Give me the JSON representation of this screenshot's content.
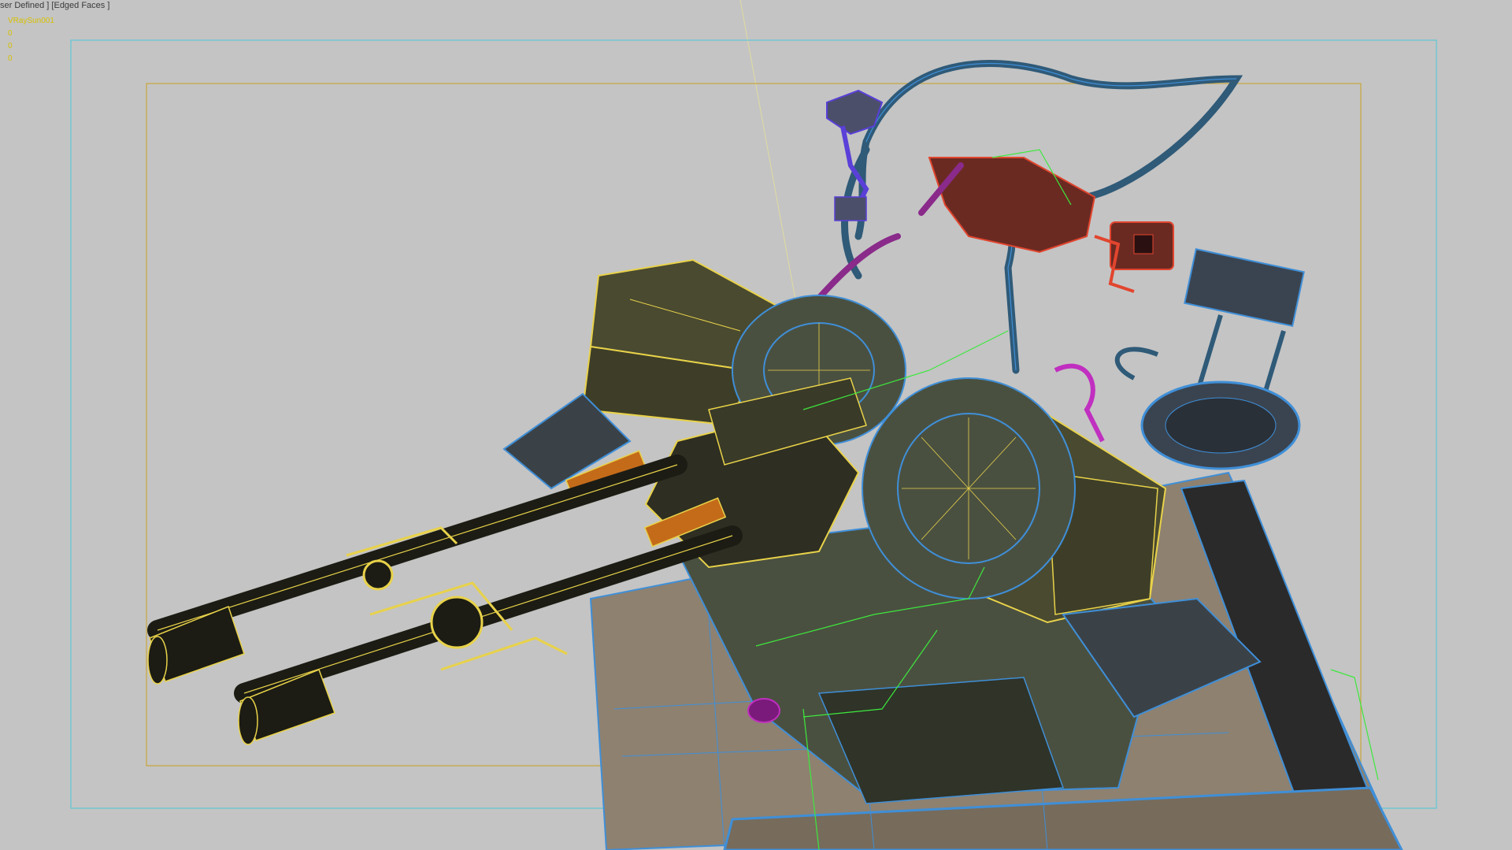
{
  "viewport": {
    "label": "ser Defined ] [Edged Faces ]",
    "selected_object": "VRaySun001",
    "stats": [
      "0",
      "0",
      "0"
    ]
  },
  "colors": {
    "background": "#c4c4c4",
    "safe_frame_outer": "#5fc7d6",
    "safe_frame_inner": "#c9a53a",
    "wire_yellow": "#e8d24a",
    "wire_blue": "#3f8fd8",
    "wire_green": "#3de83d",
    "wire_red": "#e2452e",
    "wire_magenta": "#c02fc0",
    "wire_purple": "#5a3fd8"
  },
  "icons": [
    "wireframe-turret-model"
  ]
}
